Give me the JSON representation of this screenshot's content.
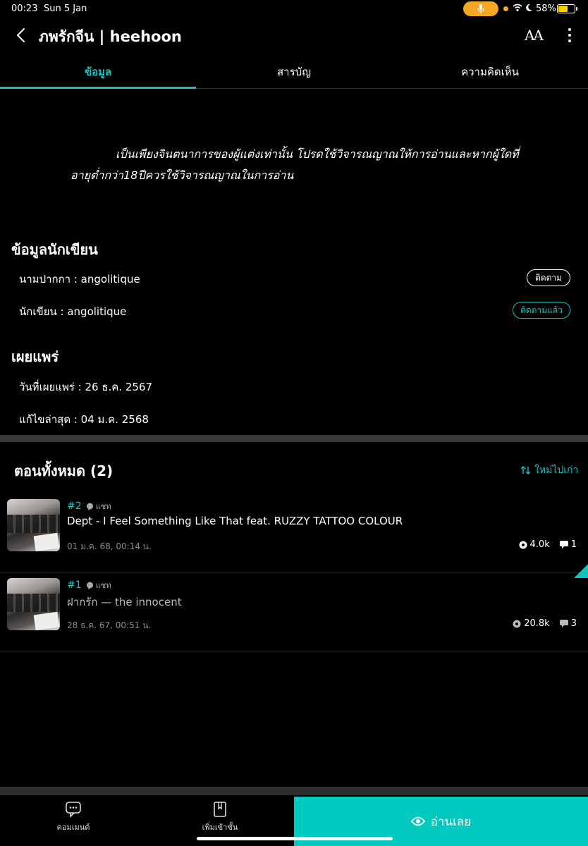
{
  "status_bar": {
    "time": "00:23",
    "date": "Sun 5 Jan",
    "battery": "58%",
    "battery_level": 0.58
  },
  "header": {
    "title": "ภพรักจีน | heehoon",
    "font_label": "AA"
  },
  "tabs": [
    {
      "label": "ข้อมูล",
      "active": true
    },
    {
      "label": "สารบัญ",
      "active": false
    },
    {
      "label": "ความคิดเห็น",
      "active": false
    }
  ],
  "intro": "เป็นเพียงจินตนาการของผู้แต่งเท่านั้น โปรดใช้วิจารณญาณให้การอ่านและหากผู้ใดที่อายุต่ำกว่า18ปีควรใช้วิจารณญาณในการอ่าน",
  "author_info": {
    "heading": "ข้อมูลนักเขียน",
    "pen_name": "นามปากกา : angolitique",
    "follow_label": "ติดตาม",
    "writer": "นักเขียน : angolitique",
    "followed_label": "ติดตามแล้ว"
  },
  "publish": {
    "heading": "เผยแพร่",
    "published": "วันที่เผยแพร่ : 26 ธ.ค. 2567",
    "updated": "แก้ไขล่าสุด : 04 ม.ค. 2568"
  },
  "episodes": {
    "heading": "ตอนทั้งหมด (2)",
    "sort_label": "ใหม่ไปเก่า",
    "items": [
      {
        "num": "#2",
        "tag": "แชท",
        "title": "Dept - I Feel Something Like That feat. RUZZY TATTOO COLOUR",
        "date": "01 ม.ค. 68, 00:14 น.",
        "views": "4.0k",
        "comments": "1"
      },
      {
        "num": "#1",
        "tag": "แชท",
        "title": "ฝากรัก — the innocent",
        "date": "28 ธ.ค. 67, 00:51 น.",
        "views": "20.8k",
        "comments": "3"
      }
    ]
  },
  "bottom": {
    "comment_label": "คอมเมนต์",
    "shelf_label": "เพิ่มเข้าชั้น",
    "read_label": "อ่านเลย"
  },
  "colors": {
    "accent": "#12c3c0",
    "read_button": "#00c9c0"
  }
}
